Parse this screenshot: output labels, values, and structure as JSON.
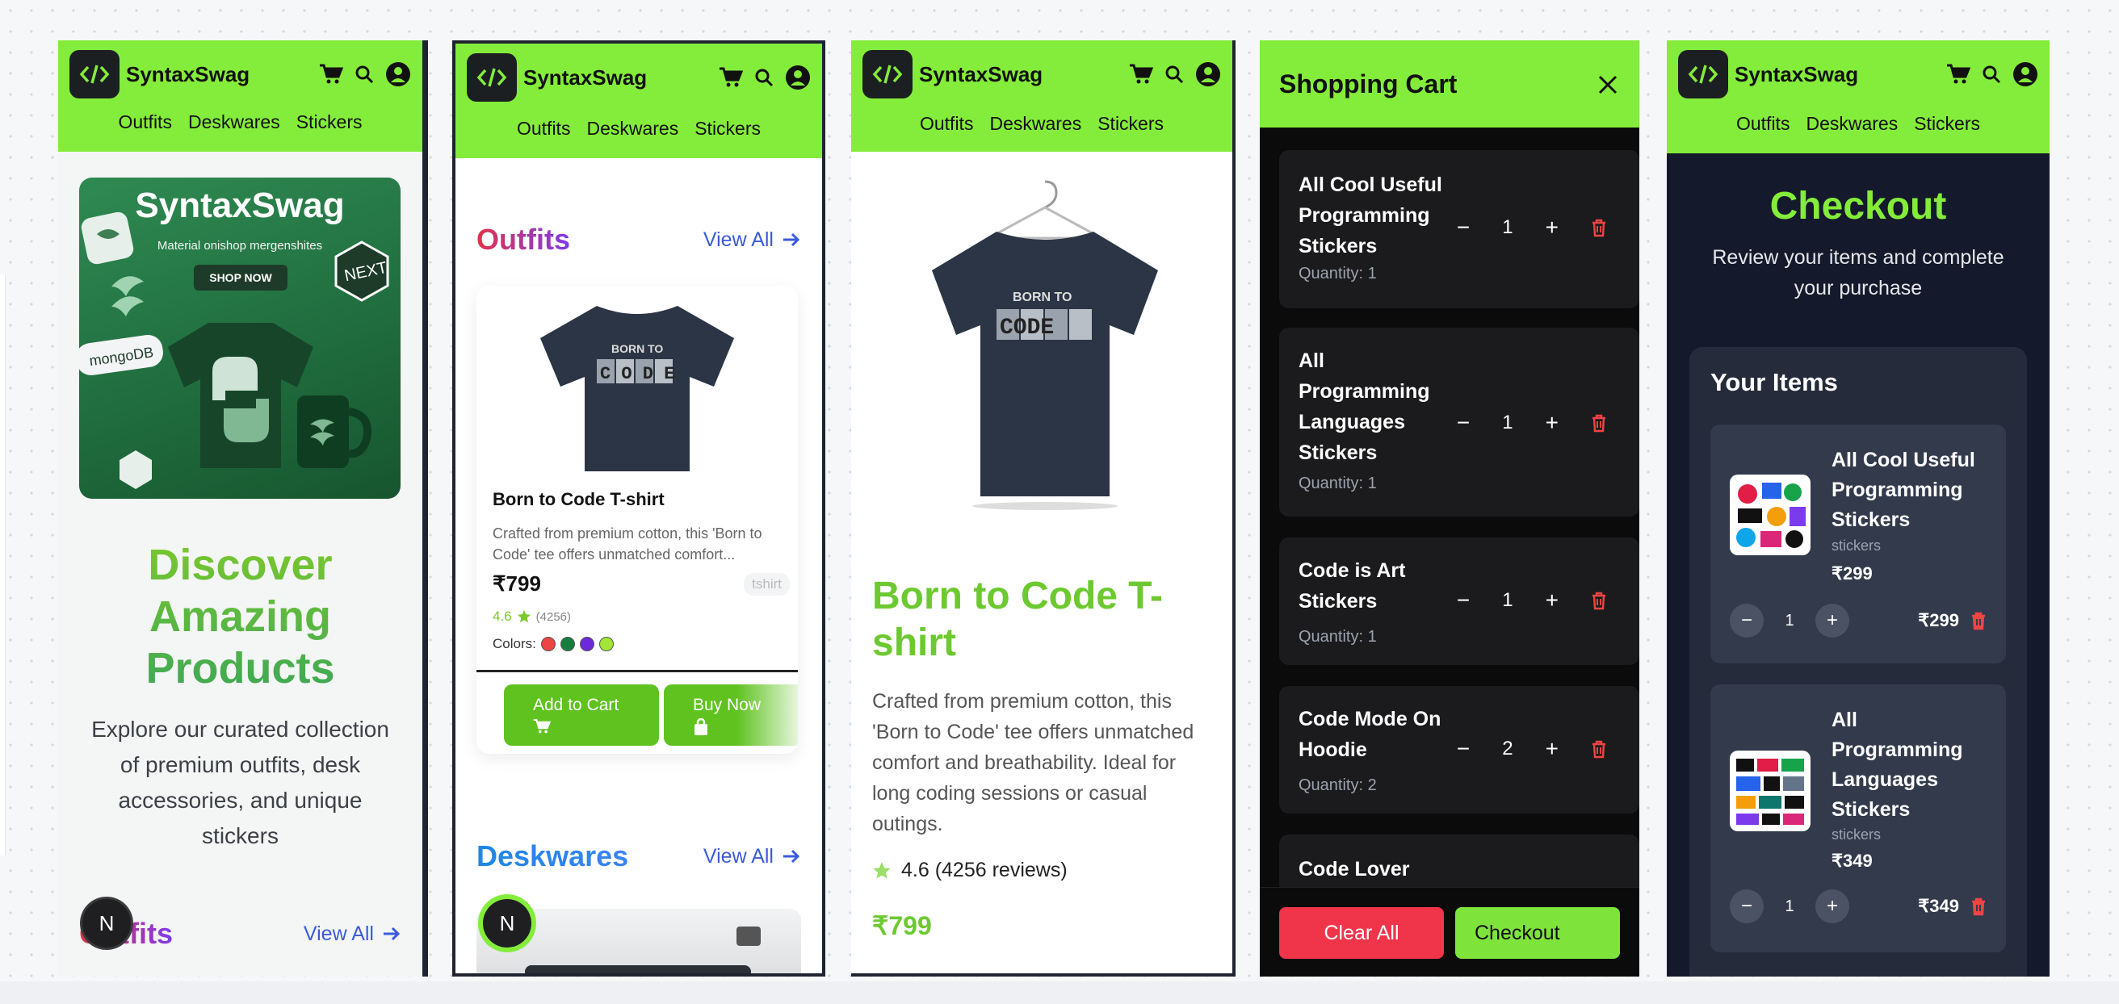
{
  "brand": "SyntaxSwag",
  "nav": [
    "Outfits",
    "Deskwares",
    "Stickers"
  ],
  "icons": {
    "cart": "cart-icon",
    "search": "search-icon",
    "account": "user-icon"
  },
  "colors": {
    "accent_green": "#84ec3a",
    "danger": "#f0344a",
    "link_blue": "#3b5bdb"
  },
  "home": {
    "hero_title": "SyntaxSwag",
    "hero_subtitle": "Material onishop mergenshites",
    "hero_button": "SHOP NOW",
    "hero_badge": "NEXT",
    "hero_label": "mongoDB",
    "headline": "Discover Amazing Products",
    "intro": "Explore our curated collection of premium outfits, desk accessories, and unique stickers",
    "section": "Outfits",
    "view_all": "View All",
    "fab": "N"
  },
  "listing": {
    "section1": "Outfits",
    "section2": "Deskwares",
    "view_all": "View All",
    "product": {
      "name": "Born to Code T-shirt",
      "description": "Crafted from premium cotton, this 'Born to Code' tee offers unmatched comfort...",
      "price": "₹799",
      "tag": "tshirt",
      "rating": "4.6",
      "reviews": "(4256)",
      "colors_label": "Colors:",
      "colors": [
        "#ef4444",
        "#15803d",
        "#6d28d9",
        "#a3e635"
      ],
      "add_to_cart": "Add to Cart",
      "buy_now": "Buy Now"
    },
    "fab": "N"
  },
  "detail": {
    "title": "Born to Code T-shirt",
    "description": "Crafted from premium cotton, this 'Born to Code' tee offers unmatched comfort and breathability. Ideal for long coding sessions or casual outings.",
    "rating": "4.6 (4256 reviews)",
    "price": "₹799"
  },
  "cart": {
    "title": "Shopping Cart",
    "items": [
      {
        "name": "All Cool Useful Programming Stickers",
        "quantity_label": "Quantity: 1",
        "qty": "1"
      },
      {
        "name": "All Programming Languages Stickers",
        "quantity_label": "Quantity: 1",
        "qty": "1"
      },
      {
        "name": "Code is Art Stickers",
        "quantity_label": "Quantity: 1",
        "qty": "1"
      },
      {
        "name": "Code Mode On Hoodie",
        "quantity_label": "Quantity: 2",
        "qty": "2"
      },
      {
        "name": "Code Lover",
        "quantity_label": "",
        "qty": ""
      }
    ],
    "clear_all": "Clear All",
    "checkout": "Checkout"
  },
  "checkout": {
    "title": "Checkout",
    "subtitle": "Review your items and complete your purchase",
    "panel_title": "Your Items",
    "items": [
      {
        "name": "All Cool Useful Programming Stickers",
        "category": "stickers",
        "price": "₹299",
        "qty": "1",
        "line_total": "₹299"
      },
      {
        "name": "All Programming Languages Stickers",
        "category": "stickers",
        "price": "₹349",
        "qty": "1",
        "line_total": "₹349"
      }
    ]
  }
}
